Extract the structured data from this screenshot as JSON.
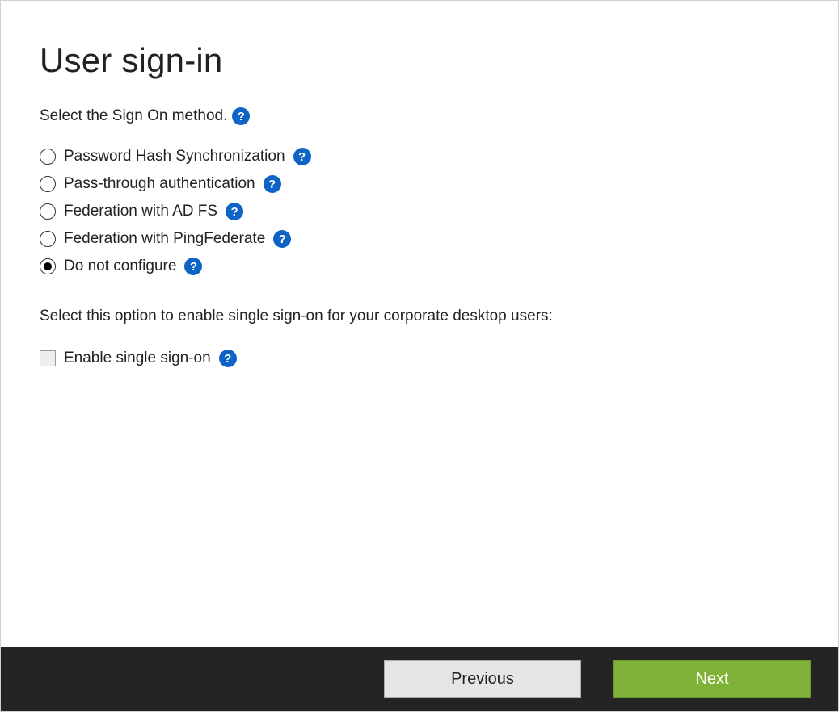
{
  "page": {
    "title": "User sign-in",
    "instruction": "Select the Sign On method.",
    "sso_instruction": "Select this option to enable single sign-on for your corporate desktop users:"
  },
  "help_glyph": "?",
  "options": {
    "password_hash": "Password Hash Synchronization",
    "pass_through": "Pass-through authentication",
    "federation_adfs": "Federation with AD FS",
    "federation_ping": "Federation with PingFederate",
    "do_not_configure": "Do not configure"
  },
  "selected_option": "do_not_configure",
  "sso_checkbox": {
    "label": "Enable single sign-on",
    "checked": false,
    "enabled": false
  },
  "footer": {
    "previous": "Previous",
    "next": "Next"
  },
  "colors": {
    "help_icon_bg": "#0e64c5",
    "footer_bg": "#242424",
    "primary_btn_bg": "#7fb238",
    "secondary_btn_bg": "#e5e5e5"
  }
}
